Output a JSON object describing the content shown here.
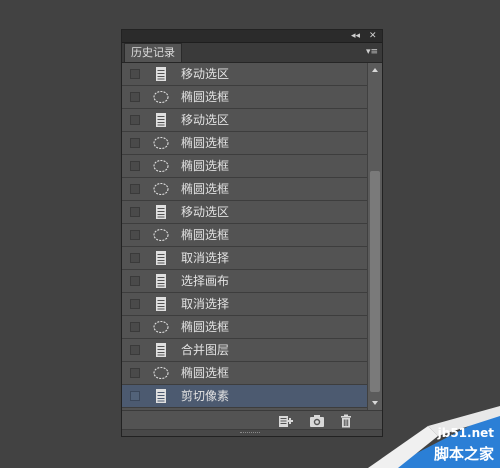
{
  "panel": {
    "collapse_icon": "double-chevron-left-icon",
    "close_icon": "close-icon",
    "tab_label": "历史记录",
    "menu_icon": "panel-menu-icon"
  },
  "history": {
    "items": [
      {
        "label": "移动选区",
        "icon": "document-icon",
        "selected": false
      },
      {
        "label": "椭圆选框",
        "icon": "ellipse-marquee-icon",
        "selected": false
      },
      {
        "label": "移动选区",
        "icon": "document-icon",
        "selected": false
      },
      {
        "label": "椭圆选框",
        "icon": "ellipse-marquee-icon",
        "selected": false
      },
      {
        "label": "椭圆选框",
        "icon": "ellipse-marquee-icon",
        "selected": false
      },
      {
        "label": "椭圆选框",
        "icon": "ellipse-marquee-icon",
        "selected": false
      },
      {
        "label": "移动选区",
        "icon": "document-icon",
        "selected": false
      },
      {
        "label": "椭圆选框",
        "icon": "ellipse-marquee-icon",
        "selected": false
      },
      {
        "label": "取消选择",
        "icon": "document-icon",
        "selected": false
      },
      {
        "label": "选择画布",
        "icon": "document-icon",
        "selected": false
      },
      {
        "label": "取消选择",
        "icon": "document-icon",
        "selected": false
      },
      {
        "label": "椭圆选框",
        "icon": "ellipse-marquee-icon",
        "selected": false
      },
      {
        "label": "合并图层",
        "icon": "document-icon",
        "selected": false
      },
      {
        "label": "椭圆选框",
        "icon": "ellipse-marquee-icon",
        "selected": false
      },
      {
        "label": "剪切像素",
        "icon": "document-icon",
        "selected": true
      }
    ]
  },
  "bottom_buttons": [
    {
      "name": "new-document-from-state-icon"
    },
    {
      "name": "camera-snapshot-icon"
    },
    {
      "name": "trash-icon"
    }
  ],
  "watermark": {
    "site": "jb51.net",
    "name": "脚本之家"
  },
  "colors": {
    "background": "#424242",
    "panel": "#535353",
    "selected_row": "#4c5a70",
    "watermark_accent": "#2b7fd6"
  }
}
